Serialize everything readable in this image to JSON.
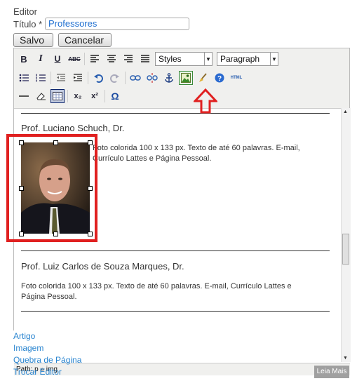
{
  "form": {
    "heading": "Editor",
    "title_label": "Título *",
    "title_value": "Professores",
    "save_label": "Salvo",
    "cancel_label": "Cancelar"
  },
  "toolbar": {
    "row1": {
      "bold": "B",
      "italic": "I",
      "underline": "U",
      "strike": "ABC",
      "styles_select": "Styles",
      "format_select": "Paragraph"
    },
    "html_label": "HTML",
    "charmap": "Ω",
    "sub": "x₂",
    "sup": "x²"
  },
  "content": {
    "entries": [
      {
        "name": "Prof. Luciano Schuch, Dr.",
        "description_line1": "Foto colorida 100 x 133 px. Texto de até 60 palavras. E-mail,",
        "description_line2": "Currículo Lattes e Página Pessoal."
      },
      {
        "name": "Prof. Luiz Carlos de Souza Marques, Dr.",
        "description_line1": "Foto colorida 100 x 133 px. Texto de até 60 palavras. E-mail, Currículo Lattes e",
        "description_line2": "Página Pessoal."
      }
    ]
  },
  "statusbar": {
    "path": "Path: p » img"
  },
  "links": [
    "Artigo",
    "Imagem",
    "Quebra de Página",
    "Trocar Editor"
  ],
  "readmore": "Leia Mais",
  "colors": {
    "highlight": "#e02020",
    "link": "#2a85d0"
  }
}
